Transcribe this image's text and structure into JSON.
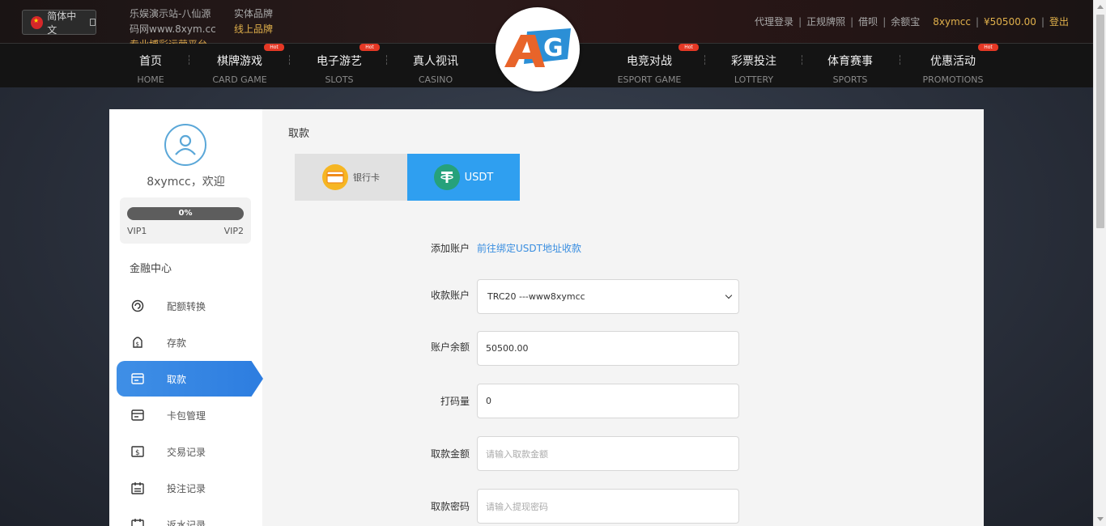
{
  "header": {
    "language": "简体中文",
    "ticker_lines": [
      "乐娱演示站-八仙源",
      "码网www.8xym.cc",
      "专业博彩运营平台"
    ],
    "brand_links": [
      "实体品牌",
      "线上品牌"
    ],
    "right_links": [
      "代理登录",
      "正规牌照",
      "借呗",
      "余额宝"
    ],
    "username": "8xymcc",
    "balance": "¥50500.00",
    "logout": "登出",
    "logo_text": "AG"
  },
  "nav": {
    "items": [
      {
        "cn": "首页",
        "en": "HOME",
        "hot": ""
      },
      {
        "cn": "棋牌游戏",
        "en": "CARD GAME",
        "hot": "Hot"
      },
      {
        "cn": "电子游艺",
        "en": "SLOTS",
        "hot": "Hot"
      },
      {
        "cn": "真人视讯",
        "en": "CASINO",
        "hot": ""
      },
      {
        "cn": "电竞对战",
        "en": "ESPORT GAME",
        "hot": "Hot"
      },
      {
        "cn": "彩票投注",
        "en": "LOTTERY",
        "hot": ""
      },
      {
        "cn": "体育赛事",
        "en": "SPORTS",
        "hot": ""
      },
      {
        "cn": "优惠活动",
        "en": "PROMOTIONS",
        "hot": "Hot"
      }
    ]
  },
  "sidebar": {
    "welcome": "8xymcc，欢迎",
    "vip_progress_label": "0%",
    "vip_progress": 0,
    "vip_from": "VIP1",
    "vip_to": "VIP2",
    "section_title": "金融中心",
    "menu": [
      {
        "label": "配额转换",
        "icon": "transfer-icon"
      },
      {
        "label": "存款",
        "icon": "deposit-icon"
      },
      {
        "label": "取款",
        "icon": "withdraw-icon"
      },
      {
        "label": "卡包管理",
        "icon": "card-icon"
      },
      {
        "label": "交易记录",
        "icon": "transaction-icon"
      },
      {
        "label": "投注记录",
        "icon": "bet-record-icon"
      },
      {
        "label": "返水记录",
        "icon": "rebate-icon"
      }
    ]
  },
  "main": {
    "title": "取款",
    "tabs": [
      {
        "label": "银行卡",
        "icon": "bank-card-icon"
      },
      {
        "label": "USDT",
        "icon": "usdt-icon"
      }
    ],
    "form": {
      "add_account_label": "添加账户",
      "add_account_link": "前往绑定USDT地址收款",
      "receive_account_label": "收款账户",
      "receive_account_value": "TRC20 ---www8xymcc",
      "balance_label": "账户余额",
      "balance_value": "50500.00",
      "wager_label": "打码量",
      "wager_value": "0",
      "amount_label": "取款金额",
      "amount_placeholder": "请输入取款金额",
      "password_label": "取款密码",
      "password_placeholder": "请输入提现密码"
    }
  },
  "colors": {
    "accent_blue": "#2f9ff0",
    "gold": "#e0b04b",
    "hot_red": "#e53825"
  }
}
